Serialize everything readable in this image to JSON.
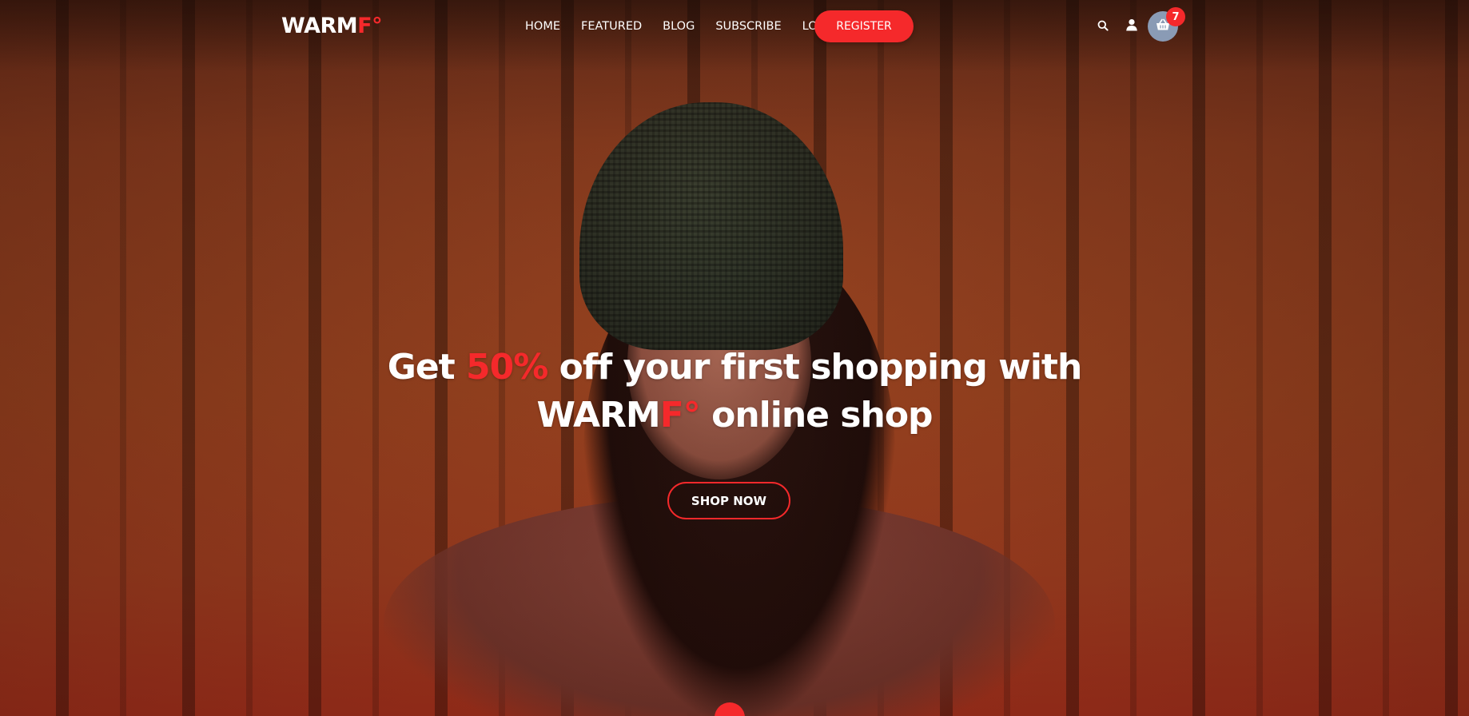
{
  "header": {
    "logo": {
      "main": "WARM",
      "accent": "F°"
    },
    "nav": [
      "HOME",
      "FEATURED",
      "BLOG",
      "SUBSCRIBE",
      "LOGIN"
    ],
    "register_label": "REGISTER",
    "cart_count": "7",
    "icons": {
      "search": "search-icon",
      "user": "user-icon",
      "cart": "basket-icon"
    }
  },
  "hero": {
    "headline": {
      "prefix": "Get ",
      "highlight": "50%",
      "mid": " off your first shopping with",
      "brand_main": "WARM",
      "brand_accent": "F°",
      "suffix": " online shop"
    },
    "cta_label": "SHOP NOW"
  },
  "colors": {
    "accent": "#f5292b",
    "cart_bg": "#8a9bb5",
    "text": "#ffffff"
  }
}
